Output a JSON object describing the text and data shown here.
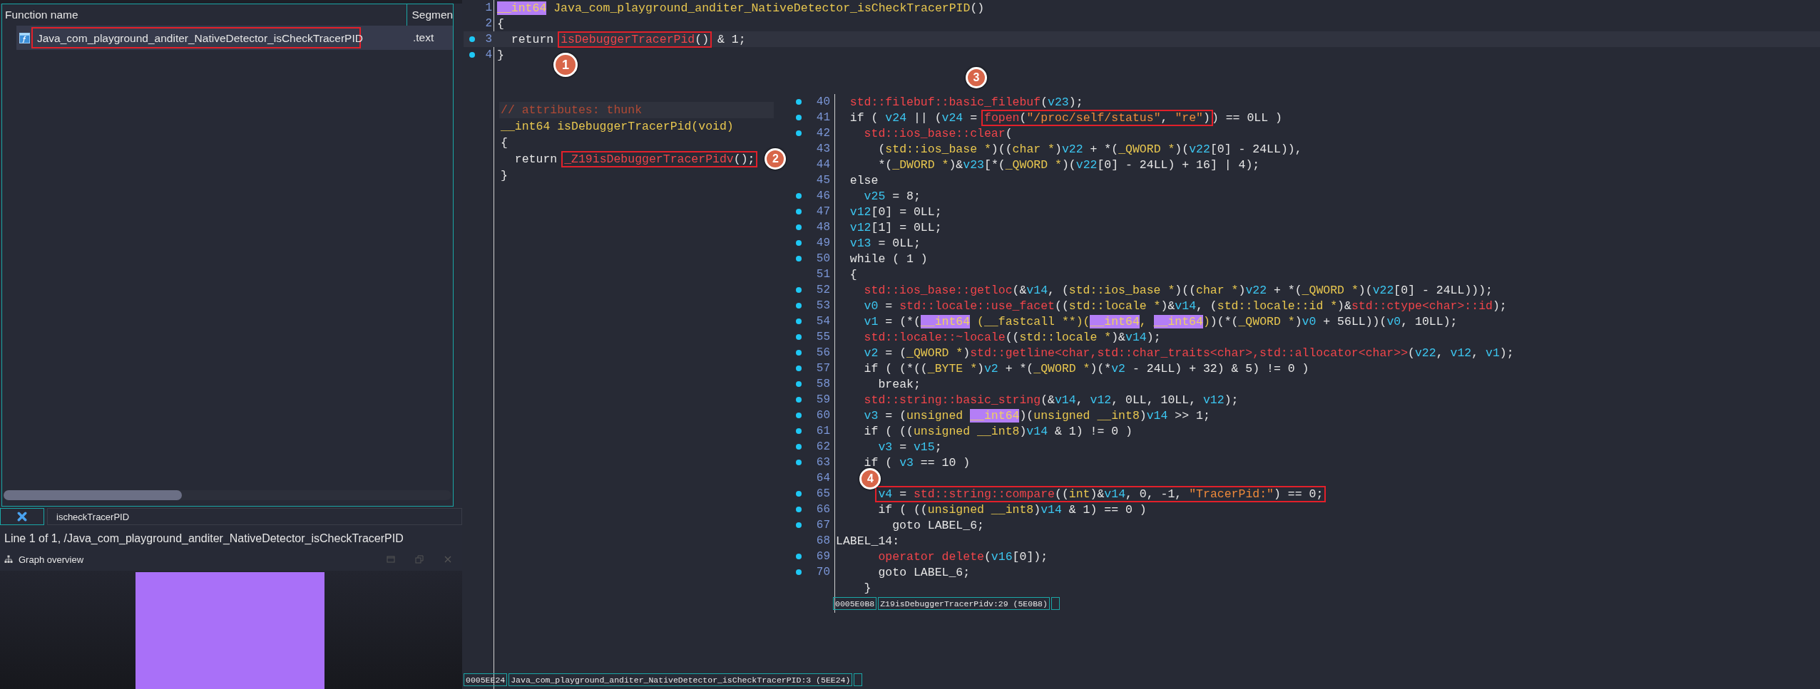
{
  "function_list": {
    "columns": [
      "Function name",
      "Segmen"
    ],
    "rows": [
      {
        "name": "Java_com_playground_anditer_NativeDetector_isCheckTracerPID",
        "segment": ".text",
        "selected": true,
        "annotated": true
      }
    ],
    "filter": "ischeckTracerPID"
  },
  "status_line": "Line 1 of 1, /Java_com_playground_anditer_NativeDetector_isCheckTracerPID",
  "graph_overview": {
    "title": "Graph overview"
  },
  "main_view": {
    "lines": [
      {
        "num": "1",
        "dot": false,
        "current": false,
        "tokens": [
          {
            "text": "__int64",
            "kind": "hl"
          },
          {
            "text": " Java_com_playground_anditer_NativeDetector_isCheckTracerPID",
            "kind": "type"
          },
          {
            "text": "()",
            "kind": "plain"
          }
        ]
      },
      {
        "num": "2",
        "dot": false,
        "current": false,
        "tokens": [
          {
            "text": "{",
            "kind": "plain"
          }
        ]
      },
      {
        "num": "3",
        "dot": true,
        "current": true,
        "tokens": [
          {
            "text": "  return ",
            "kind": "plain"
          },
          {
            "badge": "1",
            "tokens": [
              {
                "text": "isDebuggerTracerPid",
                "kind": "func"
              },
              {
                "text": "()",
                "kind": "plain"
              }
            ]
          },
          {
            "text": " & 1;",
            "kind": "plain"
          }
        ]
      },
      {
        "num": "4",
        "dot": true,
        "current": false,
        "tokens": [
          {
            "text": "}",
            "kind": "plain"
          }
        ]
      }
    ],
    "status": {
      "address": "0005EE24",
      "location": "Java_com_playground_anditer_NativeDetector_isCheckTracerPID:3 (5EE24)"
    }
  },
  "thunk_popup": {
    "lines": [
      {
        "tokens": [
          {
            "text": "// attributes: thunk",
            "kind": "comment"
          }
        ]
      },
      {
        "tokens": [
          {
            "text": "__int64 isDebuggerTracerPid(void)",
            "kind": "type"
          }
        ]
      },
      {
        "tokens": [
          {
            "text": "{",
            "kind": "plain"
          }
        ]
      },
      {
        "tokens": [
          {
            "text": "  return ",
            "kind": "plain"
          },
          {
            "badge": "2",
            "tokens": [
              {
                "text": "_Z19isDebuggerTracerPidv",
                "kind": "func"
              },
              {
                "text": "();",
                "kind": "plain"
              }
            ]
          }
        ]
      },
      {
        "tokens": [
          {
            "text": "}",
            "kind": "plain"
          }
        ]
      }
    ]
  },
  "callee_popup": {
    "lines": [
      {
        "num": "40",
        "dot": true,
        "tokens": [
          {
            "text": "  std::filebuf::basic_filebuf",
            "kind": "func"
          },
          {
            "text": "(",
            "kind": "plain"
          },
          {
            "text": "v23",
            "kind": "var"
          },
          {
            "text": ");",
            "kind": "plain"
          }
        ]
      },
      {
        "num": "41",
        "dot": true,
        "tokens": [
          {
            "text": "  if ( ",
            "kind": "plain"
          },
          {
            "text": "v24",
            "kind": "var"
          },
          {
            "text": " || (",
            "kind": "plain"
          },
          {
            "text": "v24",
            "kind": "var"
          },
          {
            "text": " = ",
            "kind": "plain"
          },
          {
            "badge": "3",
            "tokens": [
              {
                "text": "fopen",
                "kind": "func"
              },
              {
                "text": "(",
                "kind": "plain"
              },
              {
                "text": "\"/proc/self/status\"",
                "kind": "str"
              },
              {
                "text": ", ",
                "kind": "plain"
              },
              {
                "text": "\"re\"",
                "kind": "str"
              },
              {
                "text": ")",
                "kind": "plain"
              }
            ]
          },
          {
            "text": ") == 0LL )",
            "kind": "plain"
          }
        ]
      },
      {
        "num": "42",
        "dot": true,
        "tokens": [
          {
            "text": "    std::ios_base::clear",
            "kind": "func"
          },
          {
            "text": "(",
            "kind": "plain"
          }
        ]
      },
      {
        "num": "43",
        "dot": false,
        "tokens": [
          {
            "text": "      (",
            "kind": "plain"
          },
          {
            "text": "std::ios_base *",
            "kind": "type"
          },
          {
            "text": ")((",
            "kind": "plain"
          },
          {
            "text": "char *",
            "kind": "type"
          },
          {
            "text": ")",
            "kind": "plain"
          },
          {
            "text": "v22",
            "kind": "var"
          },
          {
            "text": " + *(",
            "kind": "plain"
          },
          {
            "text": "_QWORD *",
            "kind": "type"
          },
          {
            "text": ")(",
            "kind": "plain"
          },
          {
            "text": "v22",
            "kind": "var"
          },
          {
            "text": "[0] - 24LL)),",
            "kind": "plain"
          }
        ]
      },
      {
        "num": "44",
        "dot": false,
        "tokens": [
          {
            "text": "      *(",
            "kind": "plain"
          },
          {
            "text": "_DWORD *",
            "kind": "type"
          },
          {
            "text": ")&",
            "kind": "plain"
          },
          {
            "text": "v23",
            "kind": "var"
          },
          {
            "text": "[*(",
            "kind": "plain"
          },
          {
            "text": "_QWORD *",
            "kind": "type"
          },
          {
            "text": ")(",
            "kind": "plain"
          },
          {
            "text": "v22",
            "kind": "var"
          },
          {
            "text": "[0] - 24LL) + 16] | 4);",
            "kind": "plain"
          }
        ]
      },
      {
        "num": "45",
        "dot": false,
        "tokens": [
          {
            "text": "  else",
            "kind": "plain"
          }
        ]
      },
      {
        "num": "46",
        "dot": true,
        "tokens": [
          {
            "text": "    v25",
            "kind": "var"
          },
          {
            "text": " = 8;",
            "kind": "plain"
          }
        ]
      },
      {
        "num": "47",
        "dot": true,
        "tokens": [
          {
            "text": "  v12",
            "kind": "var"
          },
          {
            "text": "[0] = 0LL;",
            "kind": "plain"
          }
        ]
      },
      {
        "num": "48",
        "dot": true,
        "tokens": [
          {
            "text": "  v12",
            "kind": "var"
          },
          {
            "text": "[1] = 0LL;",
            "kind": "plain"
          }
        ]
      },
      {
        "num": "49",
        "dot": true,
        "tokens": [
          {
            "text": "  v13",
            "kind": "var"
          },
          {
            "text": " = 0LL;",
            "kind": "plain"
          }
        ]
      },
      {
        "num": "50",
        "dot": true,
        "tokens": [
          {
            "text": "  while ( 1 )",
            "kind": "plain"
          }
        ]
      },
      {
        "num": "51",
        "dot": false,
        "tokens": [
          {
            "text": "  {",
            "kind": "plain"
          }
        ]
      },
      {
        "num": "52",
        "dot": true,
        "tokens": [
          {
            "text": "    std::ios_base::getloc",
            "kind": "func"
          },
          {
            "text": "(&",
            "kind": "plain"
          },
          {
            "text": "v14",
            "kind": "var"
          },
          {
            "text": ", (",
            "kind": "plain"
          },
          {
            "text": "std::ios_base *",
            "kind": "type"
          },
          {
            "text": ")((",
            "kind": "plain"
          },
          {
            "text": "char *",
            "kind": "type"
          },
          {
            "text": ")",
            "kind": "plain"
          },
          {
            "text": "v22",
            "kind": "var"
          },
          {
            "text": " + *(",
            "kind": "plain"
          },
          {
            "text": "_QWORD *",
            "kind": "type"
          },
          {
            "text": ")(",
            "kind": "plain"
          },
          {
            "text": "v22",
            "kind": "var"
          },
          {
            "text": "[0] - 24LL)));",
            "kind": "plain"
          }
        ]
      },
      {
        "num": "53",
        "dot": true,
        "tokens": [
          {
            "text": "    v0",
            "kind": "var"
          },
          {
            "text": " = ",
            "kind": "plain"
          },
          {
            "text": "std::locale::use_facet",
            "kind": "func"
          },
          {
            "text": "((",
            "kind": "plain"
          },
          {
            "text": "std::locale *",
            "kind": "type"
          },
          {
            "text": ")&",
            "kind": "plain"
          },
          {
            "text": "v14",
            "kind": "var"
          },
          {
            "text": ", (",
            "kind": "plain"
          },
          {
            "text": "std::locale::id *",
            "kind": "type"
          },
          {
            "text": ")&",
            "kind": "plain"
          },
          {
            "text": "std::ctype<char>::id",
            "kind": "func"
          },
          {
            "text": ");",
            "kind": "plain"
          }
        ]
      },
      {
        "num": "54",
        "dot": true,
        "tokens": [
          {
            "text": "    v1",
            "kind": "var"
          },
          {
            "text": " = (*(",
            "kind": "plain"
          },
          {
            "text": "__int64",
            "kind": "hl"
          },
          {
            "text": " (__fastcall **)(",
            "kind": "type"
          },
          {
            "text": "__int64",
            "kind": "hl"
          },
          {
            "text": ", ",
            "kind": "type"
          },
          {
            "text": "__int64",
            "kind": "hl"
          },
          {
            "text": ")",
            "kind": "type"
          },
          {
            "text": ")(*(",
            "kind": "plain"
          },
          {
            "text": "_QWORD *",
            "kind": "type"
          },
          {
            "text": ")",
            "kind": "plain"
          },
          {
            "text": "v0",
            "kind": "var"
          },
          {
            "text": " + 56LL))(",
            "kind": "plain"
          },
          {
            "text": "v0",
            "kind": "var"
          },
          {
            "text": ", 10LL);",
            "kind": "plain"
          }
        ]
      },
      {
        "num": "55",
        "dot": true,
        "tokens": [
          {
            "text": "    std::locale::~locale",
            "kind": "func"
          },
          {
            "text": "((",
            "kind": "plain"
          },
          {
            "text": "std::locale *",
            "kind": "type"
          },
          {
            "text": ")&",
            "kind": "plain"
          },
          {
            "text": "v14",
            "kind": "var"
          },
          {
            "text": ");",
            "kind": "plain"
          }
        ]
      },
      {
        "num": "56",
        "dot": true,
        "tokens": [
          {
            "text": "    v2",
            "kind": "var"
          },
          {
            "text": " = (",
            "kind": "plain"
          },
          {
            "text": "_QWORD *",
            "kind": "type"
          },
          {
            "text": ")",
            "kind": "plain"
          },
          {
            "text": "std::getline<char,std::char_traits<char>,std::allocator<char>>",
            "kind": "func"
          },
          {
            "text": "(",
            "kind": "plain"
          },
          {
            "text": "v22",
            "kind": "var"
          },
          {
            "text": ", ",
            "kind": "plain"
          },
          {
            "text": "v12",
            "kind": "var"
          },
          {
            "text": ", ",
            "kind": "plain"
          },
          {
            "text": "v1",
            "kind": "var"
          },
          {
            "text": ");",
            "kind": "plain"
          }
        ]
      },
      {
        "num": "57",
        "dot": true,
        "tokens": [
          {
            "text": "    if ( (*((",
            "kind": "plain"
          },
          {
            "text": "_BYTE *",
            "kind": "type"
          },
          {
            "text": ")",
            "kind": "plain"
          },
          {
            "text": "v2",
            "kind": "var"
          },
          {
            "text": " + *(",
            "kind": "plain"
          },
          {
            "text": "_QWORD *",
            "kind": "type"
          },
          {
            "text": ")(*",
            "kind": "plain"
          },
          {
            "text": "v2",
            "kind": "var"
          },
          {
            "text": " - 24LL) + 32) & 5) != 0 )",
            "kind": "plain"
          }
        ]
      },
      {
        "num": "58",
        "dot": true,
        "tokens": [
          {
            "text": "      break;",
            "kind": "plain"
          }
        ]
      },
      {
        "num": "59",
        "dot": true,
        "tokens": [
          {
            "text": "    std::string::basic_string",
            "kind": "func"
          },
          {
            "text": "(&",
            "kind": "plain"
          },
          {
            "text": "v14",
            "kind": "var"
          },
          {
            "text": ", ",
            "kind": "plain"
          },
          {
            "text": "v12",
            "kind": "var"
          },
          {
            "text": ", 0LL, 10LL, ",
            "kind": "plain"
          },
          {
            "text": "v12",
            "kind": "var"
          },
          {
            "text": ");",
            "kind": "plain"
          }
        ]
      },
      {
        "num": "60",
        "dot": true,
        "tokens": [
          {
            "text": "    v3",
            "kind": "var"
          },
          {
            "text": " = (",
            "kind": "plain"
          },
          {
            "text": "unsigned ",
            "kind": "type"
          },
          {
            "text": "__int64",
            "kind": "hl"
          },
          {
            "text": ")(",
            "kind": "plain"
          },
          {
            "text": "unsigned __int8",
            "kind": "type"
          },
          {
            "text": ")",
            "kind": "plain"
          },
          {
            "text": "v14",
            "kind": "var"
          },
          {
            "text": " >> 1;",
            "kind": "plain"
          }
        ]
      },
      {
        "num": "61",
        "dot": true,
        "tokens": [
          {
            "text": "    if ( ((",
            "kind": "plain"
          },
          {
            "text": "unsigned __int8",
            "kind": "type"
          },
          {
            "text": ")",
            "kind": "plain"
          },
          {
            "text": "v14",
            "kind": "var"
          },
          {
            "text": " & 1) != 0 )",
            "kind": "plain"
          }
        ]
      },
      {
        "num": "62",
        "dot": true,
        "tokens": [
          {
            "text": "      v3",
            "kind": "var"
          },
          {
            "text": " = ",
            "kind": "plain"
          },
          {
            "text": "v15",
            "kind": "var"
          },
          {
            "text": ";",
            "kind": "plain"
          }
        ]
      },
      {
        "num": "63",
        "dot": true,
        "tokens": [
          {
            "text": "    if ( ",
            "kind": "plain"
          },
          {
            "text": "v3",
            "kind": "var"
          },
          {
            "text": " == 10 )",
            "kind": "plain"
          }
        ]
      },
      {
        "num": "64",
        "dot": false
      },
      {
        "num": "65",
        "dot": true,
        "tokens": [
          {
            "badge": "4",
            "tokens": [
              {
                "text": "      v4",
                "kind": "var"
              },
              {
                "text": " = ",
                "kind": "plain"
              },
              {
                "text": "std::string::compare",
                "kind": "func"
              },
              {
                "text": "((",
                "kind": "plain"
              },
              {
                "text": "int",
                "kind": "type"
              },
              {
                "text": ")&",
                "kind": "plain"
              },
              {
                "text": "v14",
                "kind": "var"
              },
              {
                "text": ", 0, -1, ",
                "kind": "plain"
              },
              {
                "text": "\"TracerPid:\"",
                "kind": "str"
              },
              {
                "text": ") == 0;",
                "kind": "plain"
              }
            ]
          }
        ]
      },
      {
        "num": "66",
        "dot": true,
        "tokens": [
          {
            "text": "      if ( ((",
            "kind": "plain"
          },
          {
            "text": "unsigned __int8",
            "kind": "type"
          },
          {
            "text": ")",
            "kind": "plain"
          },
          {
            "text": "v14",
            "kind": "var"
          },
          {
            "text": " & 1) == 0 )",
            "kind": "plain"
          }
        ]
      },
      {
        "num": "67",
        "dot": true,
        "tokens": [
          {
            "text": "        goto LABEL_6;",
            "kind": "plain"
          }
        ]
      },
      {
        "num": "68",
        "dot": false,
        "tokens": [
          {
            "text": "LABEL_14:",
            "kind": "plain"
          }
        ]
      },
      {
        "num": "69",
        "dot": true,
        "tokens": [
          {
            "text": "      operator delete",
            "kind": "func"
          },
          {
            "text": "(",
            "kind": "plain"
          },
          {
            "text": "v16",
            "kind": "var"
          },
          {
            "text": "[0]);",
            "kind": "plain"
          }
        ]
      },
      {
        "num": "70",
        "dot": true,
        "tokens": [
          {
            "text": "      goto LABEL_6;",
            "kind": "plain"
          }
        ]
      },
      {
        "dot": false,
        "tokens": [
          {
            "text": "    }",
            "kind": "plain"
          }
        ]
      }
    ],
    "status": {
      "address": "0005E0B8",
      "location": "Z19isDebuggerTracerPidv:29 (5E0B8)"
    }
  }
}
